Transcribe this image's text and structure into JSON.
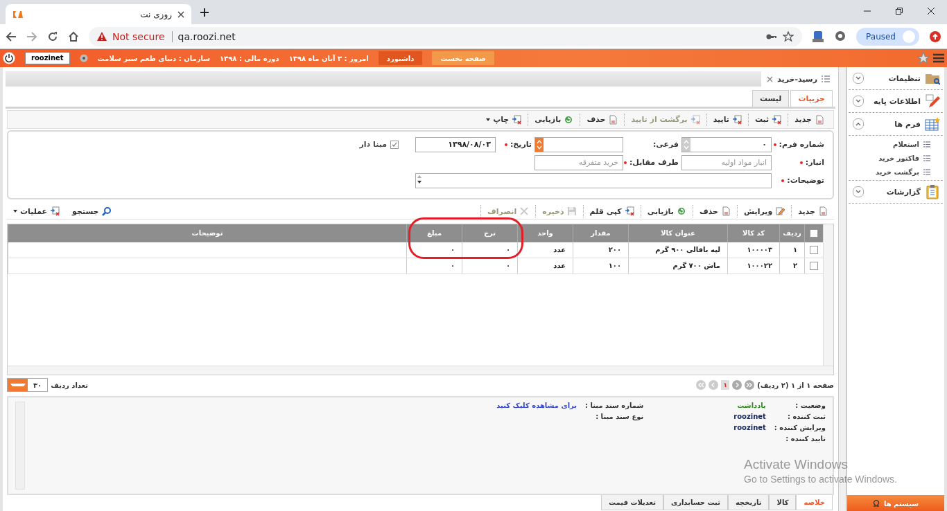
{
  "browser": {
    "tab_title": "روزی نت",
    "security": "Not secure",
    "url": "qa.roozi.net",
    "profile_status": "Paused"
  },
  "top_bar": {
    "menu_buttons": [
      {
        "label": "صفحه نخست",
        "selected": true
      },
      {
        "label": "داشبورد",
        "selected": false
      }
    ],
    "info": [
      "امروز : ۳ آبان ماه ۱۳۹۸",
      "دوره مالی : ۱۳۹۸",
      "سازمان : دنیای طعم سبز سلامت"
    ],
    "user": "roozinet"
  },
  "document_tab": {
    "title": "رسید-خرید"
  },
  "view_tabs": [
    {
      "label": "جزییات",
      "selected": true
    },
    {
      "label": "لیست",
      "selected": false
    }
  ],
  "toolbar": [
    {
      "label": "جدید",
      "disabled": false,
      "has_menu": false
    },
    {
      "label": "ثبت",
      "disabled": false,
      "has_menu": false
    },
    {
      "label": "تایید",
      "disabled": false,
      "has_menu": false
    },
    {
      "label": "برگشت از تایید",
      "disabled": true,
      "has_menu": false
    },
    {
      "label": "حذف",
      "disabled": false,
      "has_menu": false
    },
    {
      "label": "بازیابی",
      "disabled": false,
      "has_menu": false
    },
    {
      "label": "چاپ",
      "disabled": false,
      "has_menu": true
    }
  ],
  "form": {
    "rows": [
      [
        {
          "kind": "number",
          "label": "شماره فرم:",
          "required": true,
          "value": "۰"
        },
        {
          "kind": "lookup",
          "label": "فرعی:",
          "required": false
        },
        {
          "kind": "text",
          "label": "تاریخ:",
          "required": true,
          "value": "۱۳۹۸/۰۸/۰۳"
        },
        {
          "kind": "checkbox",
          "label": "مبنا دار",
          "checked": true
        }
      ],
      [
        {
          "kind": "text",
          "label": "انبار:",
          "required": true,
          "placeholder": "انبار مواد اولیه"
        },
        {
          "kind": "text",
          "label": "طرف مقابل:",
          "required": true,
          "placeholder": "خرید متفرقه"
        }
      ],
      [
        {
          "kind": "memo",
          "label": "توضیحات:",
          "required": true
        }
      ]
    ]
  },
  "grid_toolbar": {
    "actions": [
      {
        "label": "جدید",
        "disabled": false,
        "has_menu": false
      },
      {
        "label": "ویرایش",
        "disabled": false,
        "has_menu": false
      },
      {
        "label": "حذف",
        "disabled": false,
        "has_menu": false
      },
      {
        "label": "بازیابی",
        "disabled": false,
        "has_menu": false
      },
      {
        "label": "کپی قلم",
        "disabled": false,
        "has_menu": false
      },
      {
        "label": "ذخیره",
        "disabled": true,
        "has_menu": false
      },
      {
        "label": "انصراف",
        "disabled": true,
        "has_menu": false
      }
    ],
    "tools": [
      {
        "label": "جستجو",
        "disabled": false,
        "has_menu": false
      },
      {
        "label": "عملیات",
        "disabled": false,
        "has_menu": true
      }
    ]
  },
  "table": {
    "all_checked": false,
    "columns": [
      "ردیف",
      "کد کالا",
      "عنوان کالا",
      "مقدار",
      "واحد",
      "نرخ",
      "مبلغ",
      "توضیحات"
    ],
    "rows": [
      {
        "selected": false,
        "cells": [
          "۱",
          "۱۰۰۰۰۳",
          "لپه باقالی ۹۰۰ گرم",
          "۲۰۰",
          "عدد",
          "۰",
          "۰"
        ]
      },
      {
        "selected": false,
        "cells": [
          "۲",
          "۱۰۰۰۲۲",
          "ماش ۷۰۰ گرم",
          "۱۰۰",
          "عدد",
          "۰",
          "۰"
        ]
      }
    ]
  },
  "pager": {
    "summary": "صفحه ۱ از ۱ (۲ ردیف)",
    "page": "۱",
    "page_size": "۳۰",
    "page_size_label": "تعداد ردیف"
  },
  "summary": {
    "fields": [
      {
        "label": "وضعیت :",
        "value": "یادداشت",
        "kind": "status"
      },
      {
        "label": "ثبت کننده :",
        "value": "roozinet",
        "kind": "user"
      },
      {
        "label": "ویرایش کننده :",
        "value": "roozinet",
        "kind": "user"
      },
      {
        "label": "تایید کننده :"
      }
    ],
    "source_fields": [
      {
        "label": "شماره سند مبنا :",
        "value": "برای مشاهده کلیک کنید",
        "kind": "link"
      },
      {
        "label": "نوع سند مبنا :"
      }
    ]
  },
  "bottom_tabs": [
    {
      "label": "خلاصه",
      "selected": true
    },
    {
      "label": "کالا",
      "selected": false
    },
    {
      "label": "تاریخچه",
      "selected": false
    },
    {
      "label": "ثبت حسابداری",
      "selected": false
    },
    {
      "label": "تعدیلات قیمت",
      "selected": false
    }
  ],
  "sidebar": {
    "items": [
      {
        "label": "تنظیمات",
        "expanded": false
      },
      {
        "label": "اطلاعات پایه",
        "expanded": false
      },
      {
        "label": "فرم ها",
        "expanded": true,
        "children": [
          {
            "label": "استعلام"
          },
          {
            "label": "فاکتور خرید"
          },
          {
            "label": "برگشت خرید"
          }
        ]
      },
      {
        "label": "گزارشات",
        "expanded": false
      }
    ],
    "footer": "سیستم ها"
  },
  "activation": {
    "title": "Activate Windows",
    "subtitle": "Go to Settings to activate Windows."
  }
}
